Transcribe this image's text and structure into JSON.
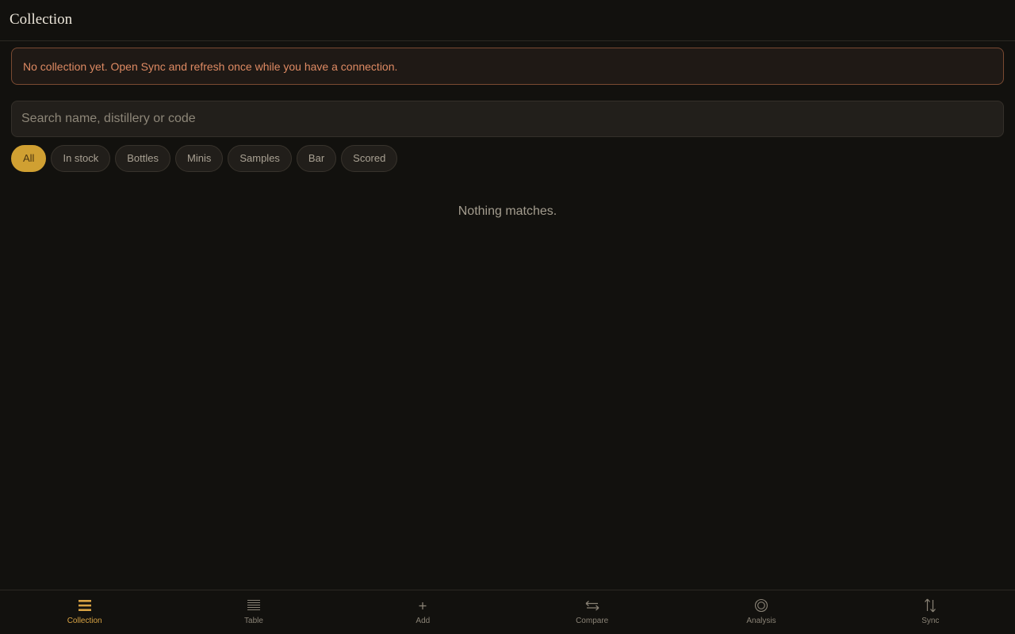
{
  "header": {
    "title": "Collection"
  },
  "banner": {
    "message": "No collection yet. Open Sync and refresh once while you have a connection."
  },
  "search": {
    "placeholder": "Search name, distillery or code",
    "value": ""
  },
  "filters": [
    {
      "label": "All",
      "active": true
    },
    {
      "label": "In stock",
      "active": false
    },
    {
      "label": "Bottles",
      "active": false
    },
    {
      "label": "Minis",
      "active": false
    },
    {
      "label": "Samples",
      "active": false
    },
    {
      "label": "Bar",
      "active": false
    },
    {
      "label": "Scored",
      "active": false
    }
  ],
  "empty_state": "Nothing matches.",
  "nav": [
    {
      "label": "Collection",
      "icon": "list-icon",
      "active": true
    },
    {
      "label": "Table",
      "icon": "table-icon",
      "active": false
    },
    {
      "label": "Add",
      "icon": "plus-icon",
      "active": false
    },
    {
      "label": "Compare",
      "icon": "swap-arrows-icon",
      "active": false
    },
    {
      "label": "Analysis",
      "icon": "target-icon",
      "active": false
    },
    {
      "label": "Sync",
      "icon": "sync-arrows-icon",
      "active": false
    }
  ],
  "colors": {
    "background": "#12110e",
    "accent": "#d0a032",
    "nav_active": "#d8a344",
    "banner_text": "#de8a63",
    "banner_border": "#7a4a32"
  }
}
